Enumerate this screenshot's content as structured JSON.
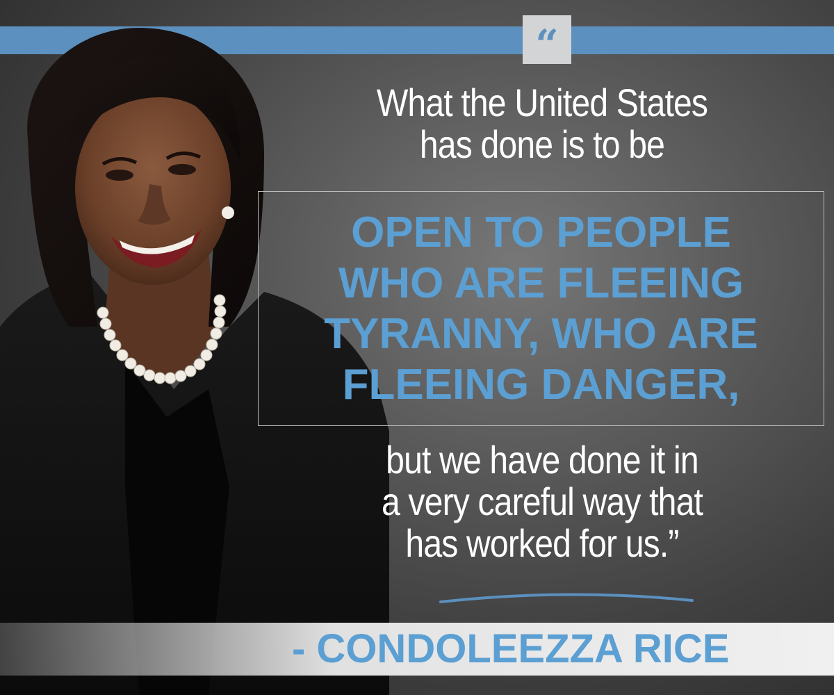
{
  "quote_mark": "“",
  "quote": {
    "intro_lines": [
      "What the United States",
      "has done is to be"
    ],
    "highlight_lines": [
      "OPEN TO PEOPLE",
      "WHO ARE FLEEING",
      "TYRANNY, WHO ARE",
      "FLEEING DANGER,"
    ],
    "outro_lines": [
      "but we have done it in",
      "a very careful way that",
      "has worked for us.”"
    ]
  },
  "attribution": "- CONDOLEEZZA RICE",
  "colors": {
    "accent_blue": "#5b90bf",
    "highlight_blue": "#5b9fd3",
    "text_white": "#ffffff",
    "quote_box": "#d3d4d5"
  }
}
